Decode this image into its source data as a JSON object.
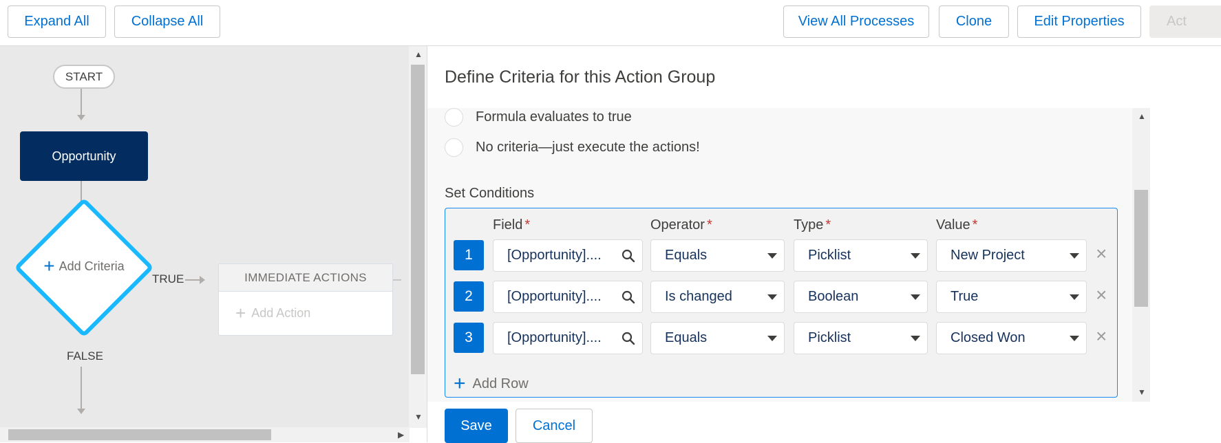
{
  "toolbar": {
    "expand_all": "Expand All",
    "collapse_all": "Collapse All",
    "view_all_processes": "View All Processes",
    "clone": "Clone",
    "edit_properties": "Edit Properties",
    "activate_partial": "Act"
  },
  "canvas": {
    "start_label": "START",
    "object_label": "Opportunity",
    "add_criteria": "Add Criteria",
    "true_label": "TRUE",
    "false_label": "FALSE",
    "immediate_actions": "IMMEDIATE ACTIONS",
    "add_action": "Add Action"
  },
  "panel": {
    "title": "Define Criteria for this Action Group",
    "options": [
      "Formula evaluates to true",
      "No criteria—just execute the actions!"
    ],
    "set_conditions": "Set Conditions",
    "columns": {
      "field": "Field",
      "operator": "Operator",
      "type": "Type",
      "value": "Value",
      "required_mark": "*"
    },
    "rows": [
      {
        "num": "1",
        "field": "[Opportunity]....",
        "operator": "Equals",
        "type": "Picklist",
        "value": "New Project"
      },
      {
        "num": "2",
        "field": "[Opportunity]....",
        "operator": "Is changed",
        "type": "Boolean",
        "value": "True"
      },
      {
        "num": "3",
        "field": "[Opportunity]....",
        "operator": "Equals",
        "type": "Picklist",
        "value": "Closed Won"
      }
    ],
    "add_row": "Add Row",
    "save": "Save",
    "cancel": "Cancel"
  },
  "icons": {
    "search": "search-icon",
    "dropdown": "chevron-down-icon",
    "remove": "close-icon",
    "add": "plus-icon"
  },
  "colors": {
    "brand_blue": "#0070d2",
    "object_node": "#032d60",
    "criteria_border": "#1ab9ff",
    "required": "#c23934"
  }
}
